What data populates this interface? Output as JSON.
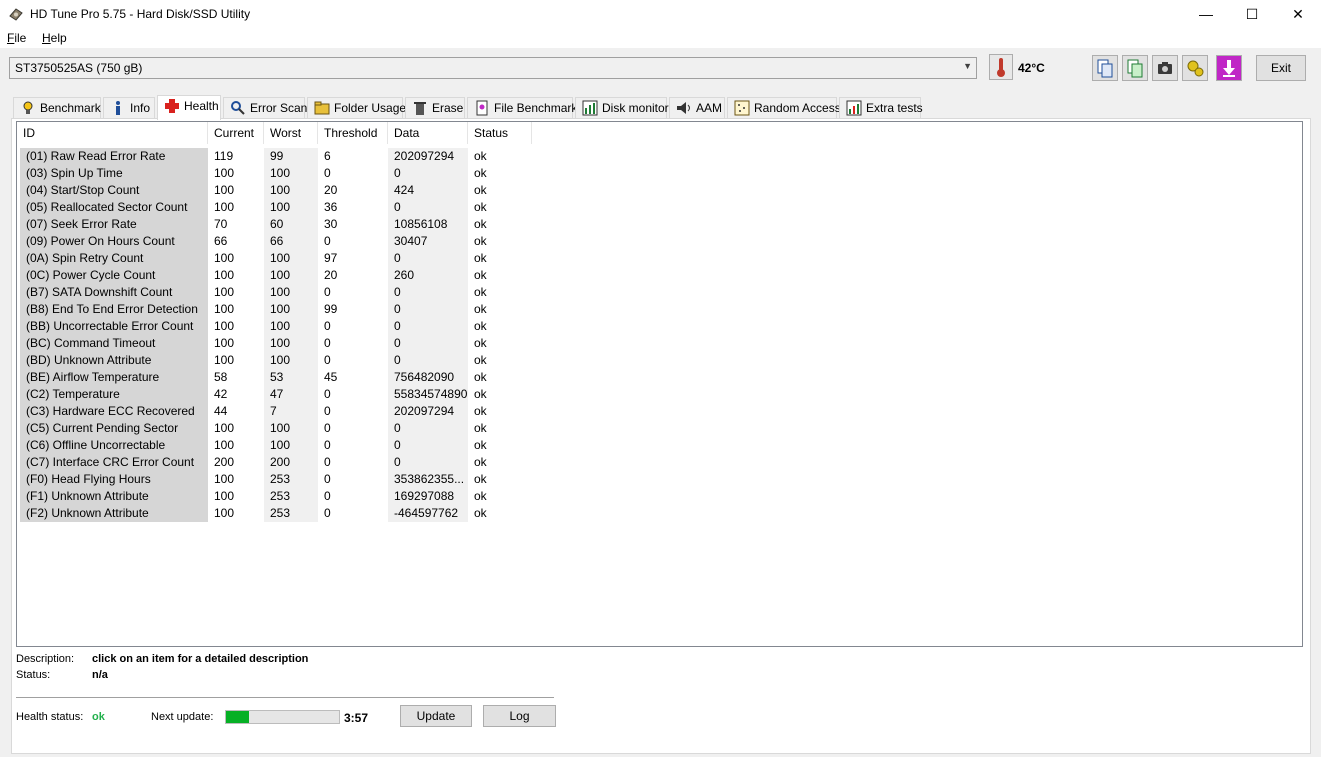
{
  "window": {
    "title": "HD Tune Pro 5.75 - Hard Disk/SSD Utility",
    "minimize": "—",
    "maximize": "☐",
    "close": "✕"
  },
  "menu": {
    "file": "File",
    "help": "Help"
  },
  "toolbar": {
    "drive": "ST3750525AS (750 gB)",
    "temperature": "42°C",
    "exit_label": "Exit"
  },
  "tabs": [
    {
      "label": "Benchmark",
      "icon": "benchmark-icon"
    },
    {
      "label": "Info",
      "icon": "info-icon"
    },
    {
      "label": "Health",
      "icon": "health-icon"
    },
    {
      "label": "Error Scan",
      "icon": "error-scan-icon"
    },
    {
      "label": "Folder Usage",
      "icon": "folder-icon"
    },
    {
      "label": "Erase",
      "icon": "erase-icon"
    },
    {
      "label": "File Benchmark",
      "icon": "file-benchmark-icon"
    },
    {
      "label": "Disk monitor",
      "icon": "disk-monitor-icon"
    },
    {
      "label": "AAM",
      "icon": "speaker-icon"
    },
    {
      "label": "Random Access",
      "icon": "random-access-icon"
    },
    {
      "label": "Extra tests",
      "icon": "extra-tests-icon"
    }
  ],
  "active_tab": "Health",
  "columns": {
    "id": "ID",
    "current": "Current",
    "worst": "Worst",
    "threshold": "Threshold",
    "data": "Data",
    "status": "Status"
  },
  "rows": [
    {
      "id": "(01) Raw Read Error Rate",
      "current": "119",
      "worst": "99",
      "threshold": "6",
      "data": "202097294",
      "status": "ok"
    },
    {
      "id": "(03) Spin Up Time",
      "current": "100",
      "worst": "100",
      "threshold": "0",
      "data": "0",
      "status": "ok"
    },
    {
      "id": "(04) Start/Stop Count",
      "current": "100",
      "worst": "100",
      "threshold": "20",
      "data": "424",
      "status": "ok"
    },
    {
      "id": "(05) Reallocated Sector Count",
      "current": "100",
      "worst": "100",
      "threshold": "36",
      "data": "0",
      "status": "ok"
    },
    {
      "id": "(07) Seek Error Rate",
      "current": "70",
      "worst": "60",
      "threshold": "30",
      "data": "10856108",
      "status": "ok"
    },
    {
      "id": "(09) Power On Hours Count",
      "current": "66",
      "worst": "66",
      "threshold": "0",
      "data": "30407",
      "status": "ok"
    },
    {
      "id": "(0A) Spin Retry Count",
      "current": "100",
      "worst": "100",
      "threshold": "97",
      "data": "0",
      "status": "ok"
    },
    {
      "id": "(0C) Power Cycle Count",
      "current": "100",
      "worst": "100",
      "threshold": "20",
      "data": "260",
      "status": "ok"
    },
    {
      "id": "(B7) SATA Downshift Count",
      "current": "100",
      "worst": "100",
      "threshold": "0",
      "data": "0",
      "status": "ok"
    },
    {
      "id": "(B8) End To End Error Detection",
      "current": "100",
      "worst": "100",
      "threshold": "99",
      "data": "0",
      "status": "ok"
    },
    {
      "id": "(BB) Uncorrectable Error Count",
      "current": "100",
      "worst": "100",
      "threshold": "0",
      "data": "0",
      "status": "ok"
    },
    {
      "id": "(BC) Command Timeout",
      "current": "100",
      "worst": "100",
      "threshold": "0",
      "data": "0",
      "status": "ok"
    },
    {
      "id": "(BD) Unknown Attribute",
      "current": "100",
      "worst": "100",
      "threshold": "0",
      "data": "0",
      "status": "ok"
    },
    {
      "id": "(BE) Airflow Temperature",
      "current": "58",
      "worst": "53",
      "threshold": "45",
      "data": "756482090",
      "status": "ok"
    },
    {
      "id": "(C2) Temperature",
      "current": "42",
      "worst": "47",
      "threshold": "0",
      "data": "55834574890",
      "status": "ok"
    },
    {
      "id": "(C3) Hardware ECC Recovered",
      "current": "44",
      "worst": "7",
      "threshold": "0",
      "data": "202097294",
      "status": "ok"
    },
    {
      "id": "(C5) Current Pending Sector",
      "current": "100",
      "worst": "100",
      "threshold": "0",
      "data": "0",
      "status": "ok"
    },
    {
      "id": "(C6) Offline Uncorrectable",
      "current": "100",
      "worst": "100",
      "threshold": "0",
      "data": "0",
      "status": "ok"
    },
    {
      "id": "(C7) Interface CRC Error Count",
      "current": "200",
      "worst": "200",
      "threshold": "0",
      "data": "0",
      "status": "ok"
    },
    {
      "id": "(F0) Head Flying Hours",
      "current": "100",
      "worst": "253",
      "threshold": "0",
      "data": "353862355...",
      "status": "ok"
    },
    {
      "id": "(F1) Unknown Attribute",
      "current": "100",
      "worst": "253",
      "threshold": "0",
      "data": "169297088",
      "status": "ok"
    },
    {
      "id": "(F2) Unknown Attribute",
      "current": "100",
      "worst": "253",
      "threshold": "0",
      "data": "-464597762",
      "status": "ok"
    }
  ],
  "description": {
    "label": "Description:",
    "value": "click on an item for a detailed description",
    "status_label": "Status:",
    "status_value": "n/a"
  },
  "footer": {
    "health_label": "Health status:",
    "health_value": "ok",
    "health_color": "#22b14c",
    "next_update_label": "Next update:",
    "timer": "3:57",
    "progress_fraction": 0.2,
    "update_label": "Update",
    "log_label": "Log"
  }
}
